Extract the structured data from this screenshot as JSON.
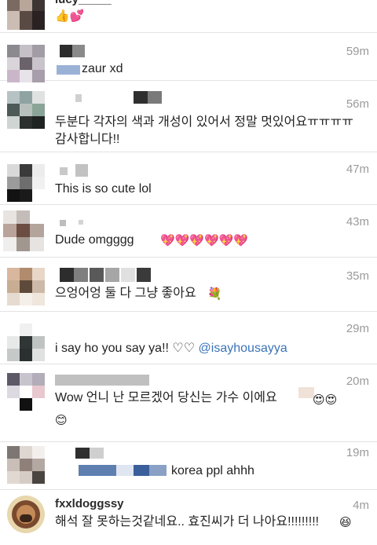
{
  "comments": [
    {
      "username": "lucy_____",
      "time": "",
      "text": "👍💕"
    },
    {
      "username": "",
      "time": "59m",
      "text": "zaur xd"
    },
    {
      "username": "",
      "time": "56m",
      "text": "두분다 각자의 색과 개성이 있어서 정말 멋있어요ㅠㅠㅠㅠ",
      "text2": "감사합니다!!"
    },
    {
      "username": "",
      "time": "47m",
      "text": "This is so cute lol"
    },
    {
      "username": "",
      "time": "43m",
      "text": "Dude omgggg",
      "emoji": "💖💖💖💖💖💖"
    },
    {
      "username": "",
      "time": "35m",
      "text": "으엉어엉 둘 다 그냥 좋아요",
      "emoji": "💐"
    },
    {
      "username": "",
      "time": "29m",
      "text": "i say ho you say ya!! ♡♡ ",
      "mention": "@isayhousayya"
    },
    {
      "username": "",
      "time": "20m",
      "text": "Wow 언니 난 모르겠어 당신는 가수 이에요",
      "emoji": "😍😍",
      "emoji2": "😊"
    },
    {
      "username": "",
      "time": "19m",
      "text": "korea ppl ahhh"
    },
    {
      "username": "fxxldoggssy",
      "time": "4m",
      "text": "해석 잘 못하는것같네요.. 효진씨가 더 나아요!!!!!!!!!",
      "emoji": "😆"
    }
  ]
}
